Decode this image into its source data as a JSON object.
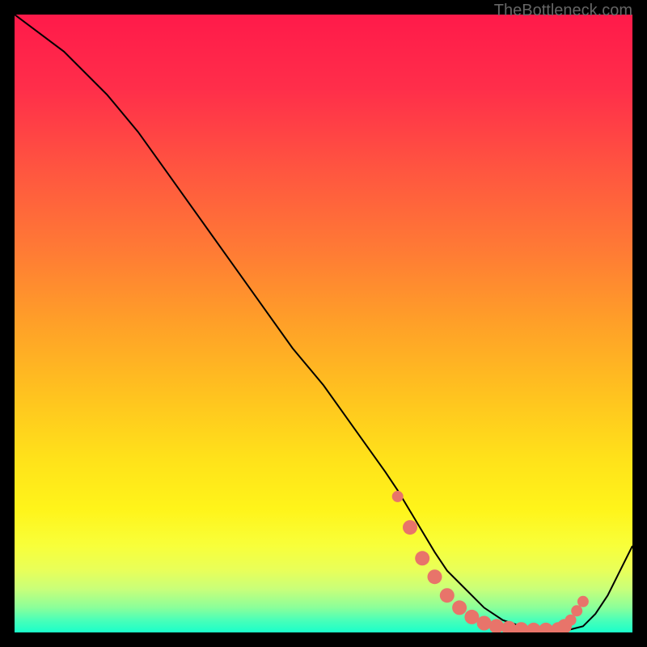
{
  "watermark": "TheBottleneck.com",
  "chart_data": {
    "type": "line",
    "title": "",
    "xlabel": "",
    "ylabel": "",
    "xlim": [
      0,
      100
    ],
    "ylim": [
      0,
      100
    ],
    "series": [
      {
        "name": "curve",
        "x": [
          0,
          8,
          15,
          20,
          25,
          30,
          35,
          40,
          45,
          50,
          55,
          60,
          62,
          65,
          68,
          70,
          73,
          76,
          79,
          82,
          85,
          88,
          90,
          92,
          94,
          96,
          98,
          100
        ],
        "y": [
          100,
          94,
          87,
          81,
          74,
          67,
          60,
          53,
          46,
          40,
          33,
          26,
          23,
          18,
          13,
          10,
          7,
          4,
          2,
          1,
          0.5,
          0.3,
          0.5,
          1,
          3,
          6,
          10,
          14
        ]
      },
      {
        "name": "dots",
        "x": [
          62,
          64,
          66,
          68,
          70,
          72,
          74,
          76,
          78,
          80,
          82,
          84,
          86,
          88,
          89,
          90,
          91,
          92
        ],
        "y": [
          22,
          17,
          12,
          9,
          6,
          4,
          2.5,
          1.5,
          1,
          0.7,
          0.5,
          0.4,
          0.4,
          0.5,
          1,
          2,
          3.5,
          5
        ]
      }
    ],
    "gradient_stops": [
      {
        "offset": 0,
        "color": "#ff1a4a"
      },
      {
        "offset": 12,
        "color": "#ff2e4a"
      },
      {
        "offset": 25,
        "color": "#ff5540"
      },
      {
        "offset": 38,
        "color": "#ff7a35"
      },
      {
        "offset": 50,
        "color": "#ffa028"
      },
      {
        "offset": 62,
        "color": "#ffc41f"
      },
      {
        "offset": 72,
        "color": "#ffe21a"
      },
      {
        "offset": 80,
        "color": "#fff41a"
      },
      {
        "offset": 86,
        "color": "#f8ff3a"
      },
      {
        "offset": 90,
        "color": "#e8ff5a"
      },
      {
        "offset": 93,
        "color": "#c8ff7a"
      },
      {
        "offset": 96,
        "color": "#8aff9a"
      },
      {
        "offset": 98,
        "color": "#4affb8"
      },
      {
        "offset": 100,
        "color": "#1affca"
      }
    ],
    "dot_color": "#e8746a",
    "line_color": "#000000"
  }
}
